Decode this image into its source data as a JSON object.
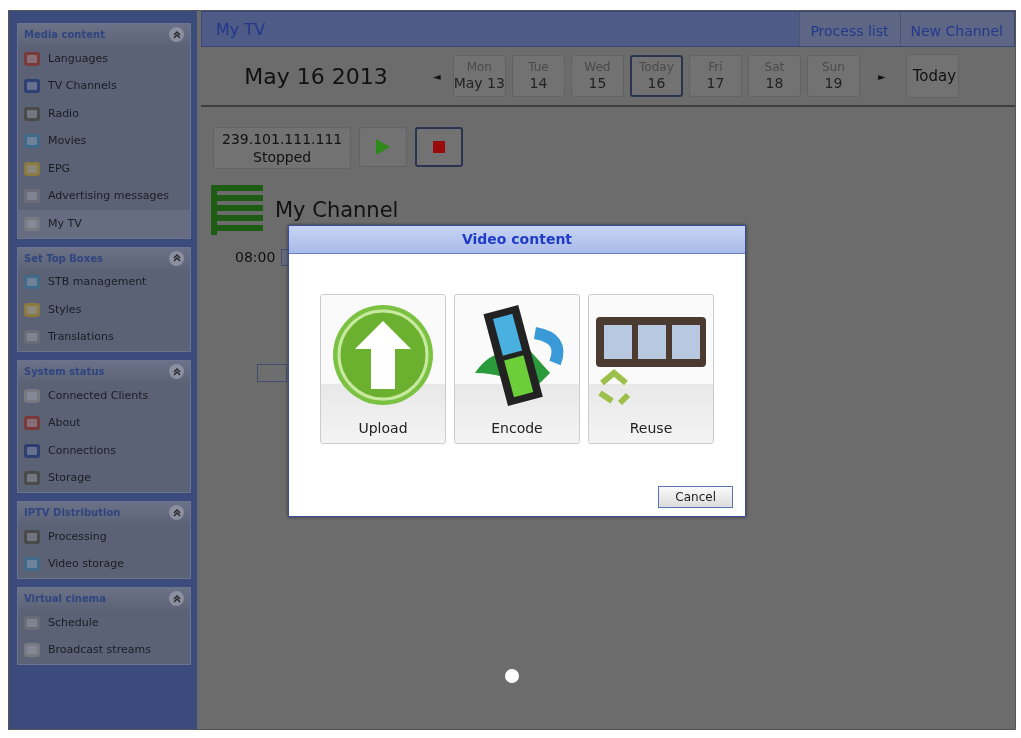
{
  "sidebar": {
    "sections": [
      {
        "title": "Media content",
        "expanded": true,
        "items": [
          {
            "label": "Languages",
            "selected": false
          },
          {
            "label": "TV Channels",
            "selected": false
          },
          {
            "label": "Radio",
            "selected": false
          },
          {
            "label": "Movies",
            "selected": false
          },
          {
            "label": "EPG",
            "selected": false
          },
          {
            "label": "Advertising messages",
            "selected": false
          },
          {
            "label": "My TV",
            "selected": true
          }
        ]
      },
      {
        "title": "Set Top Boxes",
        "expanded": true,
        "items": [
          {
            "label": "STB management",
            "selected": false
          },
          {
            "label": "Styles",
            "selected": false
          },
          {
            "label": "Translations",
            "selected": false
          }
        ]
      },
      {
        "title": "System status",
        "expanded": true,
        "items": [
          {
            "label": "Connected Clients",
            "selected": false
          },
          {
            "label": "About",
            "selected": false
          },
          {
            "label": "Connections",
            "selected": false
          },
          {
            "label": "Storage",
            "selected": false
          }
        ]
      },
      {
        "title": "IPTV Distribution",
        "expanded": true,
        "items": [
          {
            "label": "Processing",
            "selected": false
          },
          {
            "label": "Video storage",
            "selected": false
          }
        ]
      },
      {
        "title": "Virtual cinema",
        "expanded": true,
        "items": [
          {
            "label": "Schedule",
            "selected": false
          },
          {
            "label": "Broadcast streams",
            "selected": false
          }
        ]
      }
    ]
  },
  "header": {
    "title": "My TV",
    "actions": [
      "Process list",
      "New Channel"
    ]
  },
  "date_bar": {
    "current": "May 16 2013",
    "prev": "◄",
    "next": "►",
    "today_button": "Today",
    "days": [
      {
        "day": "Mon",
        "date": "May 13",
        "selected": false
      },
      {
        "day": "Tue",
        "date": "14",
        "selected": false
      },
      {
        "day": "Wed",
        "date": "15",
        "selected": false
      },
      {
        "day": "Today",
        "date": "16",
        "selected": true
      },
      {
        "day": "Fri",
        "date": "17",
        "selected": false
      },
      {
        "day": "Sat",
        "date": "18",
        "selected": false
      },
      {
        "day": "Sun",
        "date": "19",
        "selected": false
      }
    ]
  },
  "stream": {
    "address": "239.101.111.111",
    "status": "Stopped"
  },
  "channel": {
    "name": "My Channel",
    "time": "08:00"
  },
  "dialog": {
    "title": "Video content",
    "options": [
      {
        "kind": "upload",
        "label": "Upload"
      },
      {
        "kind": "encode",
        "label": "Encode"
      },
      {
        "kind": "reuse",
        "label": "Reuse"
      }
    ],
    "cancel": "Cancel"
  }
}
